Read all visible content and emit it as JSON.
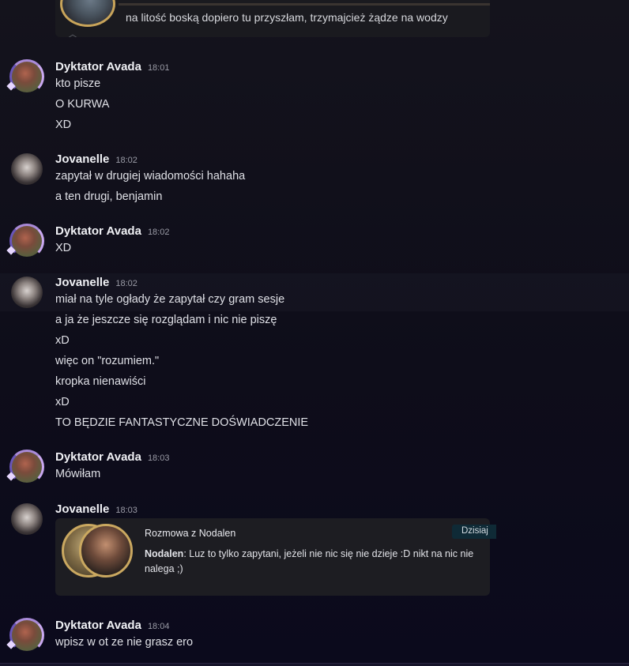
{
  "top_embed": {
    "text": "na litość boską dopiero tu przyszłam, trzymajcież żądze na wodzy",
    "chevron_icon": "chevron-up-icon"
  },
  "messages": [
    {
      "author": "Dyktator Avada",
      "time": "18:01",
      "lines": [
        "kto pisze",
        "O KURWA",
        "XD"
      ]
    },
    {
      "author": "Jovanelle",
      "time": "18:02",
      "lines": [
        "zapytał w drugiej wiadomości hahaha",
        "a ten drugi, benjamin"
      ]
    },
    {
      "author": "Dyktator Avada",
      "time": "18:02",
      "lines": [
        "XD"
      ]
    },
    {
      "author": "Jovanelle",
      "time": "18:02",
      "lines": [
        "miał na tyle ogłady że zapytał czy gram sesje",
        "a ja że jeszcze się rozglądam i nic nie piszę",
        "xD",
        "więc on \"rozumiem.\"",
        "kropka nienawiści",
        "xD",
        "TO BĘDZIE FANTASTYCZNE DOŚWIADCZENIE"
      ]
    },
    {
      "author": "Dyktator Avada",
      "time": "18:03",
      "lines": [
        "Mówiłam"
      ]
    },
    {
      "author": "Jovanelle",
      "time": "18:03",
      "lines": []
    },
    {
      "author": "Dyktator Avada",
      "time": "18:04",
      "lines": [
        "wpisz w ot ze nie grasz ero"
      ]
    }
  ],
  "embed": {
    "title": "Rozmowa z Nodalen",
    "badge": "Dzisiaj",
    "speaker": "Nodalen",
    "text": ": Luz to tylko zapytani, jeżeli nie nic się nie dzieje :D nikt na nic nie nalega ;)"
  }
}
